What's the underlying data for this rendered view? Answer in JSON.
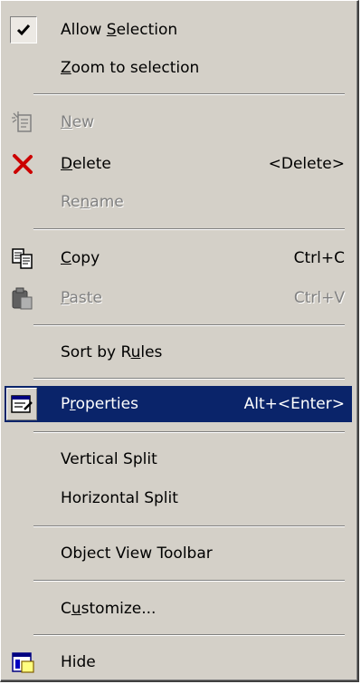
{
  "menu": {
    "items": [
      {
        "label_pre": "Allow ",
        "label_key": "S",
        "label_post": "election",
        "checked": true
      },
      {
        "label_pre": "",
        "label_key": "Z",
        "label_post": "oom to selection"
      },
      {
        "label_pre": "",
        "label_key": "N",
        "label_post": "ew",
        "disabled": true,
        "icon": "new-document-icon"
      },
      {
        "label_pre": "",
        "label_key": "D",
        "label_post": "elete",
        "accel": "<Delete>",
        "icon": "delete-x-icon"
      },
      {
        "label_pre": "Re",
        "label_key": "n",
        "label_post": "ame",
        "disabled": true
      },
      {
        "label_pre": "",
        "label_key": "C",
        "label_post": "opy",
        "accel": "Ctrl+C",
        "icon": "copy-icon"
      },
      {
        "label_pre": "",
        "label_key": "P",
        "label_post": "aste",
        "accel": "Ctrl+V",
        "disabled": true,
        "icon": "paste-icon"
      },
      {
        "label_pre": "Sort by R",
        "label_key": "u",
        "label_post": "les"
      },
      {
        "label_pre": "P",
        "label_key": "r",
        "label_post": "operties",
        "accel": "Alt+<Enter>",
        "selected": true,
        "icon": "properties-icon"
      },
      {
        "label_pre": "Vertical Split",
        "label_key": "",
        "label_post": ""
      },
      {
        "label_pre": "Horizontal Split",
        "label_key": "",
        "label_post": ""
      },
      {
        "label_pre": "Object View Toolbar",
        "label_key": "",
        "label_post": ""
      },
      {
        "label_pre": "C",
        "label_key": "u",
        "label_post": "stomize..."
      },
      {
        "label_pre": "Hide",
        "label_key": "",
        "label_post": "",
        "icon": "hide-window-icon"
      }
    ]
  },
  "colors": {
    "menu_bg": "#d4d0c8",
    "highlight": "#0a246a",
    "disabled_text": "#808080",
    "delete_icon": "#cc0000"
  }
}
